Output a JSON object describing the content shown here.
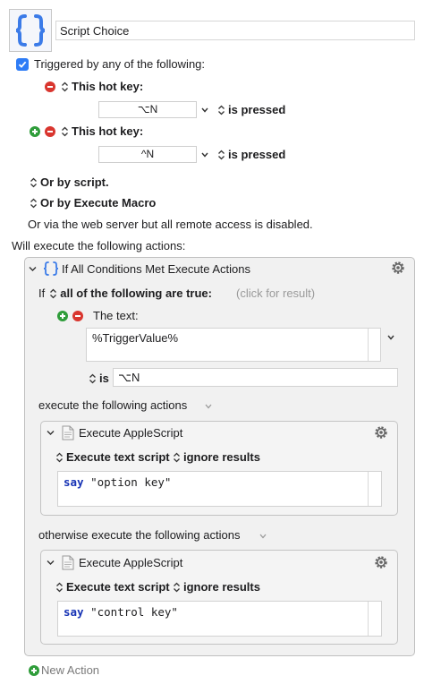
{
  "header": {
    "icon": "curly-braces-icon",
    "macro_name": "Script Choice"
  },
  "triggers": {
    "checkbox_label": "Triggered by any of the following:",
    "hotkey_label": "This hot key:",
    "hotkeys": [
      {
        "key": "⌥N",
        "condition": "is pressed"
      },
      {
        "key": "^N",
        "condition": "is pressed"
      }
    ],
    "or_by_script": "Or by script.",
    "or_by_execute_macro": "Or by Execute Macro",
    "web_server_note": "Or via the web server but all remote access is disabled."
  },
  "actions_heading": "Will execute the following actions:",
  "if_action": {
    "title": "If All Conditions Met Execute Actions",
    "if_word": "If",
    "condition_mode": "all of the following are true:",
    "click_for_result": "(click for result)",
    "condition_type": "The text:",
    "text_value": "%TriggerValue%",
    "operator": "is",
    "compare_value": "⌥N",
    "then_label": "execute the following actions",
    "else_label": "otherwise execute the following actions"
  },
  "applescript_actions": [
    {
      "title": "Execute AppleScript",
      "mode": "Execute text script",
      "result": "ignore results",
      "keyword": "say",
      "argument": "\"option key\""
    },
    {
      "title": "Execute AppleScript",
      "mode": "Execute text script",
      "result": "ignore results",
      "keyword": "say",
      "argument": "\"control key\""
    }
  ],
  "new_action_label": "New Action",
  "colors": {
    "accent_blue": "#2e7cf6",
    "remove_red": "#d9362f",
    "add_green": "#2f9d3a",
    "keyword_blue": "#1733b5"
  }
}
